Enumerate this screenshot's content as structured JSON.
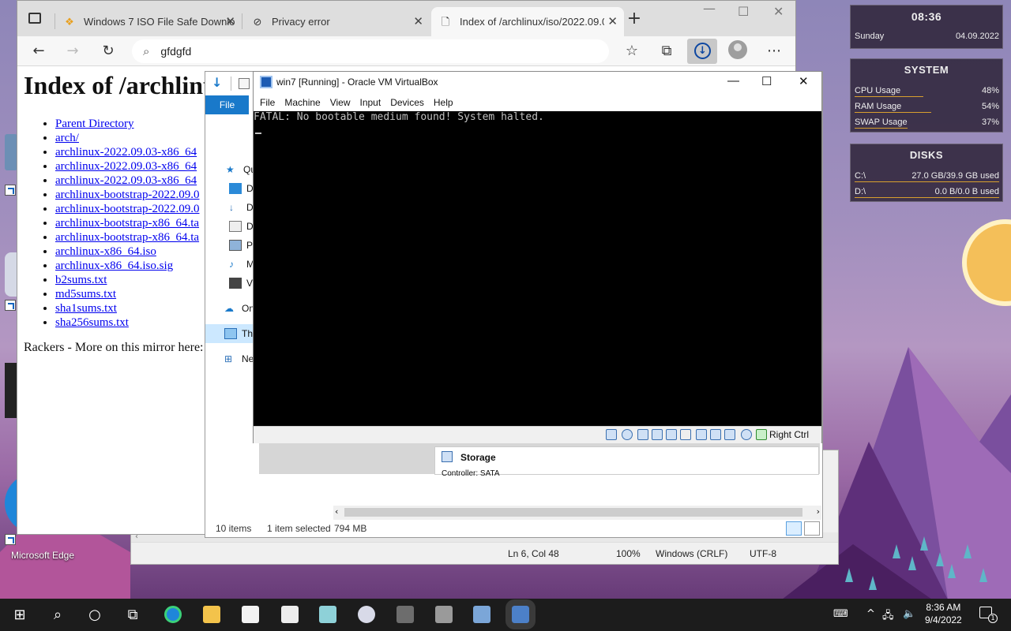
{
  "desktop": {
    "edge_label": "Microsoft Edge"
  },
  "browser": {
    "tabs": [
      {
        "title": "Windows 7 ISO File Safe Downlo",
        "icon": "windows-flag-icon"
      },
      {
        "title": "Privacy error",
        "icon": "privacy-error-icon"
      },
      {
        "title": "Index of /archlinux/iso/2022.09.0",
        "icon": "page-icon"
      }
    ],
    "new_tab_label": "+",
    "address_value": "gfdgfd",
    "page": {
      "heading": "Index of /archlinu",
      "links": [
        "Parent Directory",
        "arch/",
        "archlinux-2022.09.03-x86_64",
        "archlinux-2022.09.03-x86_64",
        "archlinux-2022.09.03-x86_64",
        "archlinux-bootstrap-2022.09.0",
        "archlinux-bootstrap-2022.09.0",
        "archlinux-bootstrap-x86_64.ta",
        "archlinux-bootstrap-x86_64.ta",
        "archlinux-x86_64.iso",
        "archlinux-x86_64.iso.sig",
        "b2sums.txt",
        "md5sums.txt",
        "sha1sums.txt",
        "sha256sums.txt"
      ],
      "footer_text": "Rackers - More on this mirror here:"
    }
  },
  "explorer": {
    "file_tab": "File",
    "nav_items": [
      "Qu",
      "D",
      "D",
      "D",
      "P",
      "M",
      "V",
      "On",
      "Thi",
      "Ne"
    ],
    "storage_label": "Storage",
    "storage_sub": "Controller: SATA",
    "status": {
      "items": "10 items",
      "selected": "1 item selected",
      "size": "794 MB"
    }
  },
  "notepad": {
    "status": {
      "position": "Ln 6, Col 48",
      "zoom": "100%",
      "line_ending": "Windows (CRLF)",
      "encoding": "UTF-8"
    }
  },
  "vbox": {
    "title": "win7 [Running] - Oracle VM VirtualBox",
    "menu": [
      "File",
      "Machine",
      "View",
      "Input",
      "Devices",
      "Help"
    ],
    "screen_text": "FATAL: No bootable medium found! System halted.",
    "host_key": "Right Ctrl"
  },
  "widgets": {
    "clock": {
      "time": "08:36",
      "day": "Sunday",
      "date": "04.09.2022"
    },
    "system": {
      "heading": "SYSTEM",
      "rows": [
        {
          "label": "CPU Usage",
          "value": "48%"
        },
        {
          "label": "RAM Usage",
          "value": "54%"
        },
        {
          "label": "SWAP Usage",
          "value": "37%"
        }
      ]
    },
    "disks": {
      "heading": "DISKS",
      "rows": [
        {
          "label": "C:\\",
          "value": "27.0 GB/39.9 GB used"
        },
        {
          "label": "D:\\",
          "value": "0.0 B/0.0 B used"
        }
      ]
    }
  },
  "taskbar": {
    "time": "8:36 AM",
    "date": "9/4/2022",
    "notification_count": "1",
    "accent": "#1c1c1c"
  }
}
